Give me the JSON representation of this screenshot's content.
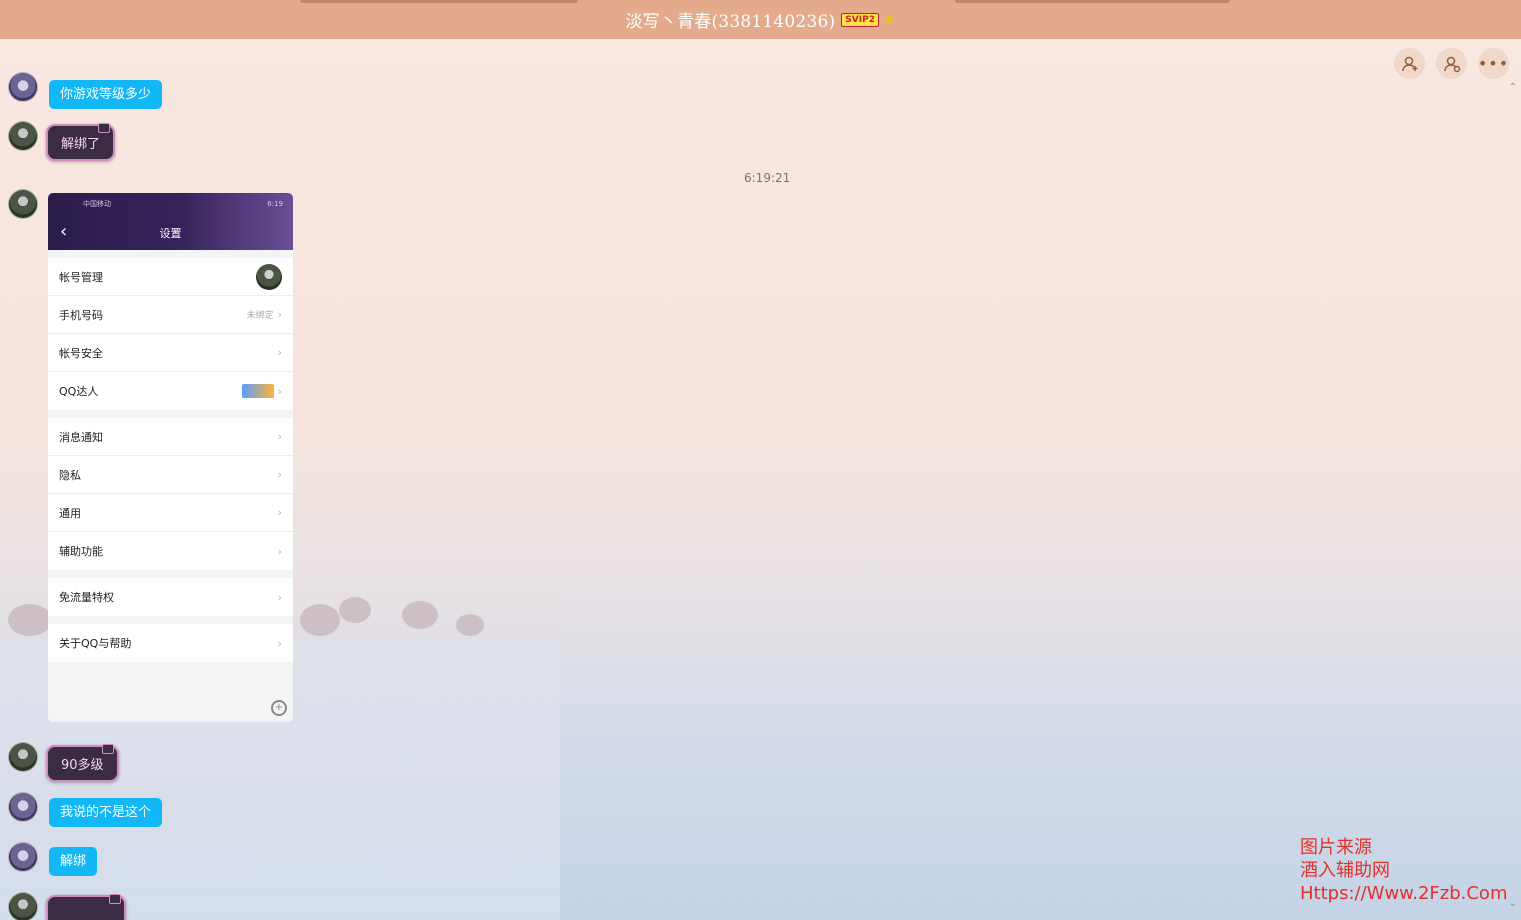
{
  "window": {
    "title": "淡写丶青春(3381140236)",
    "vip_badge": "SVIP2",
    "star_icon": "star-icon"
  },
  "actions": [
    {
      "name": "add-friend-icon"
    },
    {
      "name": "friend-settings-icon"
    },
    {
      "name": "more-icon"
    }
  ],
  "messages": {
    "m1": "你游戏等级多少",
    "m2": "解绑了",
    "timestamp": "6:19:21",
    "m3": "90多级",
    "m4": "我说的不是这个",
    "m5": "解绑"
  },
  "phone": {
    "carrier": "中国移动",
    "status_right": "6:19",
    "title": "设置",
    "groups": [
      [
        {
          "label": "帐号管理"
        },
        {
          "label": "手机号码",
          "value": "未绑定"
        },
        {
          "label": "帐号安全"
        },
        {
          "label": "QQ达人"
        }
      ],
      [
        {
          "label": "消息通知"
        },
        {
          "label": "隐私"
        },
        {
          "label": "通用"
        },
        {
          "label": "辅助功能"
        }
      ],
      [
        {
          "label": "免流量特权"
        }
      ],
      [
        {
          "label": "关于QQ与帮助"
        }
      ]
    ]
  },
  "watermark": {
    "line1": "图片来源",
    "line2": "酒入辅助网",
    "line3": "Https://Www.2Fzb.Com"
  }
}
